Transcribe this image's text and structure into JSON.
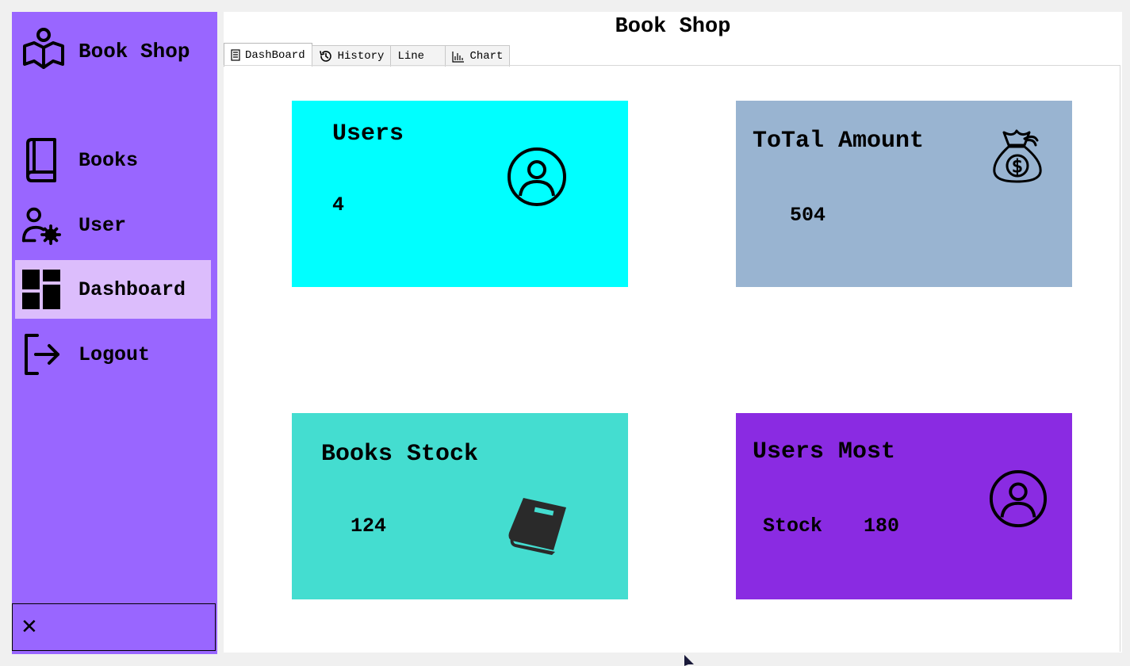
{
  "sidebar": {
    "brand": "Book Shop",
    "items": [
      {
        "label": "Books",
        "icon": "book-icon"
      },
      {
        "label": "User",
        "icon": "user-settings-icon"
      },
      {
        "label": "Dashboard",
        "icon": "dashboard-icon",
        "active": true
      },
      {
        "label": "Logout",
        "icon": "logout-icon"
      }
    ],
    "close_label": "✕"
  },
  "main": {
    "title": "Book Shop",
    "tabs": [
      {
        "label": "DashBoard",
        "icon": "document-icon",
        "active": true
      },
      {
        "label": "History",
        "icon": "history-icon"
      },
      {
        "label": "Line"
      },
      {
        "label": "Chart",
        "icon": "bar-chart-icon"
      }
    ]
  },
  "cards": {
    "users": {
      "title": "Users",
      "value": "4",
      "color": "#00ffff",
      "icon": "user-circle-icon"
    },
    "amount": {
      "title": "ToTal Amount",
      "value": "504",
      "color": "#99b4d1",
      "icon": "money-bag-icon"
    },
    "stock": {
      "title": "Books Stock",
      "value": "124",
      "color": "#44ddd0",
      "icon": "book-icon"
    },
    "most": {
      "title": "Users Most",
      "label": "Stock",
      "value": "180",
      "color": "#8a2be2",
      "icon": "user-circle-icon"
    }
  },
  "colors": {
    "sidebar": "#9966ff",
    "sidebar_active": "#dcbdfc",
    "background": "#f0f0f0"
  }
}
